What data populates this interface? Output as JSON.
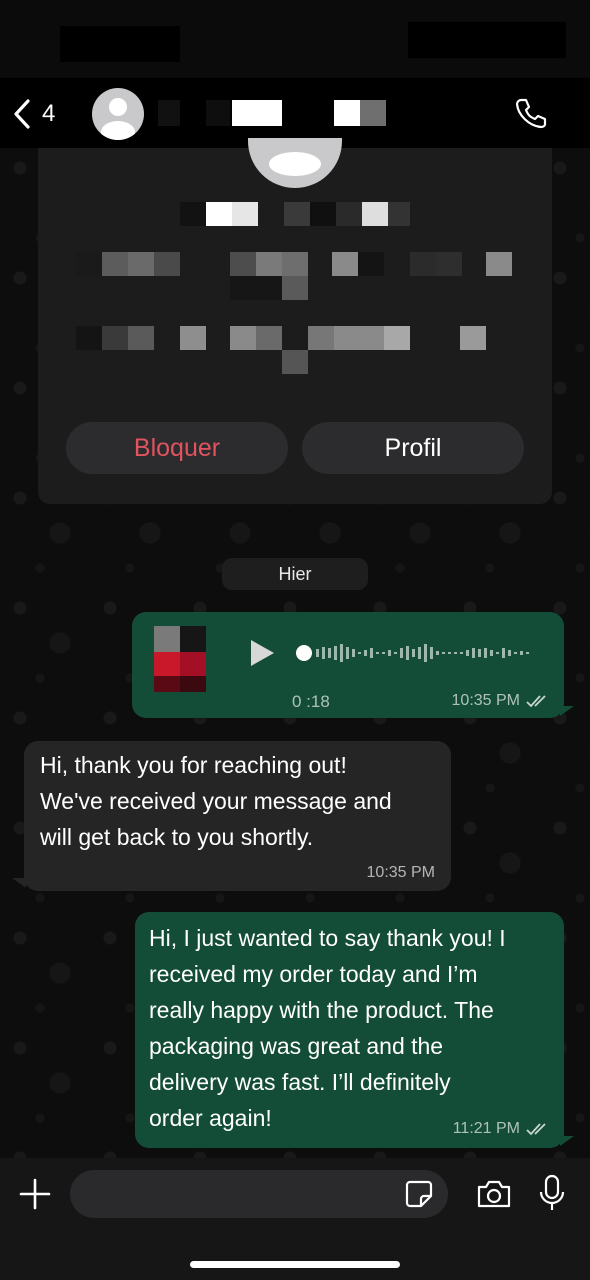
{
  "header": {
    "back_count": "4"
  },
  "profile_card": {
    "block_label": "Bloquer",
    "profile_label": "Profil",
    "block_color": "#e0535f"
  },
  "date_separator": "Hier",
  "voice_message": {
    "duration": "0 :18",
    "time": "10:35 PM"
  },
  "messages": [
    {
      "direction": "incoming",
      "text": "Hi, thank you for reaching out!\nWe've received your message and\nwill get back to you shortly.",
      "time": "10:35 PM"
    },
    {
      "direction": "outgoing",
      "text": "Hi, I just wanted to say thank you! I\nreceived my order today and I’m\nreally happy with the product. The\npackaging was great and the\ndelivery was fast. I’ll definitely\norder again!",
      "time": "11:21 PM"
    }
  ],
  "colors": {
    "outgoing_bubble": "#144d37",
    "incoming_bubble": "#252526",
    "background": "#0b0b0b"
  },
  "icons": [
    "back-chevron-icon",
    "avatar-icon",
    "phone-icon",
    "play-icon",
    "double-check-icon",
    "plus-icon",
    "sticker-icon",
    "camera-icon",
    "microphone-icon"
  ]
}
